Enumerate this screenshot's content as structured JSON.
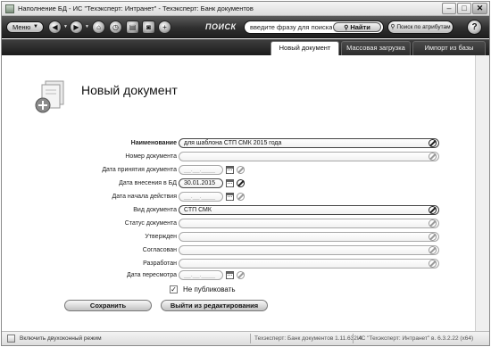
{
  "window": {
    "title": "Наполнение БД - ИС \"Техэксперт: Интранет\" - Техэксперт: Банк документов",
    "minimize": "–",
    "maximize": "□",
    "close": "✕"
  },
  "toolbar": {
    "menu_label": "Меню",
    "menu_arrow": "▼",
    "icons": [
      "back-icon",
      "forward-icon",
      "home-icon",
      "history-icon",
      "documents-icon",
      "camera-icon",
      "add-icon"
    ],
    "search_label": "ПОИСК",
    "search_value": "введите фразу для поиска",
    "find_label": "Найти",
    "attr_search_label": "Поиск по атрибутам",
    "help_label": "?"
  },
  "tabs": [
    {
      "label": "Новый документ",
      "active": true
    },
    {
      "label": "Массовая загрузка",
      "active": false
    },
    {
      "label": "Импорт из базы",
      "active": false
    }
  ],
  "page": {
    "title": "Новый документ"
  },
  "form": {
    "fields": [
      {
        "label": "Наименование",
        "value": "для шаблона СТП СМК 2015 года",
        "kind": "text",
        "required": true
      },
      {
        "label": "Номер документа",
        "value": "",
        "kind": "text"
      },
      {
        "label": "Дата принятия документа",
        "value": "__.__.____",
        "kind": "date"
      },
      {
        "label": "Дата внесения в БД",
        "value": "30.01.2015",
        "kind": "date"
      },
      {
        "label": "Дата начала действия",
        "value": "__.__.____",
        "kind": "date"
      },
      {
        "label": "Вид документа",
        "value": "СТП СМК",
        "kind": "text"
      },
      {
        "label": "Статус документа",
        "value": "",
        "kind": "text"
      },
      {
        "label": "Утвержден",
        "value": "",
        "kind": "text"
      },
      {
        "label": "Согласован",
        "value": "",
        "kind": "text"
      },
      {
        "label": "Разработан",
        "value": "",
        "kind": "text"
      },
      {
        "label": "Дата пересмотра",
        "value": "__.__.____",
        "kind": "date"
      }
    ],
    "no_publish_label": "Не публиковать",
    "no_publish_checked": true,
    "check_mark": "✓",
    "save_label": "Сохранить",
    "exit_label": "Выйти из редактирования"
  },
  "statusbar": {
    "dual_window_label": "Включить двухоконный режим",
    "version_bank": "Техэксперт: Банк документов 1.11.632.4",
    "version_is": "ИС \"Техэксперт: Интранет\" в. 6.3.2.22 (x64)"
  }
}
